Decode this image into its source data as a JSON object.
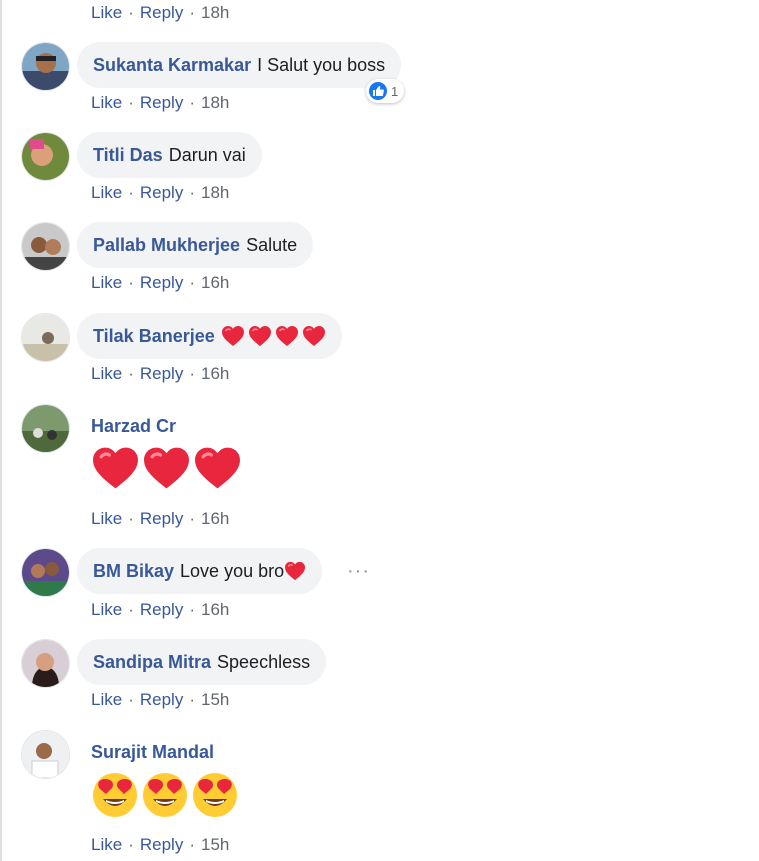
{
  "actions": {
    "like": "Like",
    "reply": "Reply",
    "separator": "·"
  },
  "top_row": {
    "time": "18h"
  },
  "comments": [
    {
      "author": "Sukanta Karmakar",
      "text": "I Salut you boss",
      "time": "18h",
      "reaction_count": "1"
    },
    {
      "author": "Titli Das",
      "text": "Darun vai",
      "time": "18h"
    },
    {
      "author": "Pallab Mukherjee",
      "text": "Salute",
      "time": "16h"
    },
    {
      "author": "Tilak Banerjee",
      "text": "",
      "time": "16h"
    },
    {
      "author": "Harzad Cr",
      "text": "",
      "time": "16h"
    },
    {
      "author": "BM Bikay",
      "text": "Love you bro",
      "time": "16h"
    },
    {
      "author": "Sandipa Mitra",
      "text": "Speechless",
      "time": "15h"
    },
    {
      "author": "Surajit Mandal",
      "text": "",
      "time": "15h"
    }
  ],
  "colors": {
    "link": "#385898",
    "muted": "#606770",
    "bubble": "#f2f3f5",
    "heart": "#e0245e",
    "like_blue": "#1877f2"
  },
  "icons": {
    "heart": "red-heart-icon",
    "heart_eyes": "smiling-face-with-heart-eyes-icon",
    "like": "thumbs-up-icon",
    "more": "more-options-icon"
  }
}
